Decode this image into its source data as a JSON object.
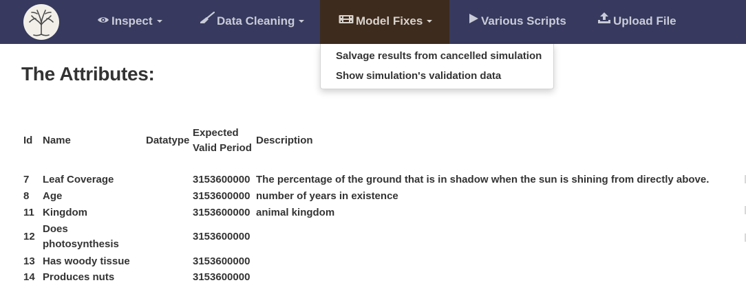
{
  "nav": {
    "items": [
      {
        "label": "Inspect",
        "icon": "eye-icon",
        "dropdown": true
      },
      {
        "label": "Data Cleaning",
        "icon": "broom-icon",
        "dropdown": true
      },
      {
        "label": "Model Fixes",
        "icon": "film-icon",
        "dropdown": true,
        "active": true
      },
      {
        "label": "Various Scripts",
        "icon": "play-icon",
        "dropdown": false
      },
      {
        "label": "Upload File",
        "icon": "upload-icon",
        "dropdown": false
      }
    ]
  },
  "dropdown": {
    "items": [
      "Salvage results from cancelled simulation",
      "Show simulation's validation data"
    ]
  },
  "page": {
    "heading": "The Attributes:"
  },
  "table": {
    "headers": {
      "id": "Id",
      "name": "Name",
      "datatype": "Datatype",
      "period_line1": "Expected",
      "period_line2": "Valid Period",
      "description": "Description"
    },
    "rows": [
      {
        "id": "7",
        "name": "Leaf Coverage",
        "datatype": "",
        "period": "3153600000",
        "description": "The percentage of the ground that is in shadow when the sun is shining from directly above."
      },
      {
        "id": "8",
        "name": "Age",
        "datatype": "",
        "period": "3153600000",
        "description": "number of years in existence"
      },
      {
        "id": "11",
        "name": "Kingdom",
        "datatype": "",
        "period": "3153600000",
        "description": "animal kingdom"
      },
      {
        "id": "12",
        "name_line1": "Does",
        "name_line2": "photosynthesis",
        "datatype": "",
        "period": "3153600000",
        "description": ""
      },
      {
        "id": "13",
        "name": "Has woody tissue",
        "datatype": "",
        "period": "3153600000",
        "description": ""
      },
      {
        "id": "14",
        "name": "Produces nuts",
        "datatype": "",
        "period": "3153600000",
        "description": ""
      }
    ]
  },
  "colors": {
    "navbar_bg": "#373a5e",
    "active_bg": "#3d2b1d",
    "nav_text": "#c9cbd8"
  }
}
